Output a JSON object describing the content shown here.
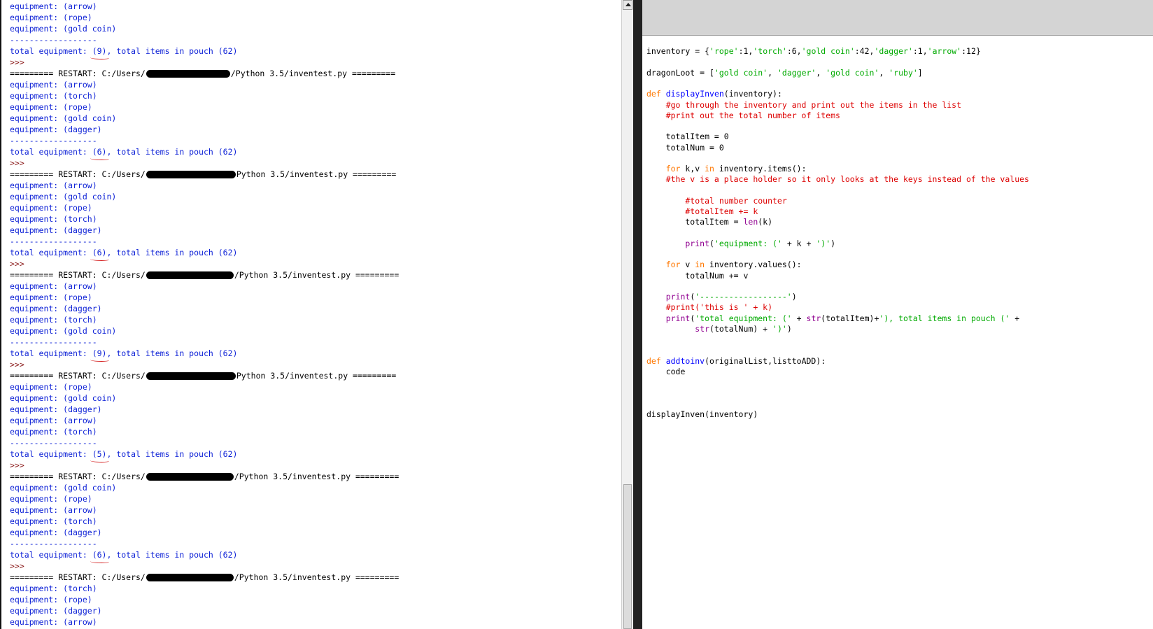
{
  "shell": {
    "lines": [
      {
        "t": "equipment: (arrow)",
        "k": "out"
      },
      {
        "t": "equipment: (rope)",
        "k": "out"
      },
      {
        "t": "equipment: (gold coin)",
        "k": "out"
      },
      {
        "t": "------------------",
        "k": "out"
      },
      {
        "pre": "total equipment: ",
        "num": "(9)",
        "post": ", total items in pouch (62)",
        "k": "total"
      },
      {
        "t": ">>>",
        "k": "prompt"
      },
      {
        "pre": "========= RESTART: C:/Users/",
        "post": "/Python 3.5/inventest.py =========",
        "k": "restart",
        "rw": 120
      },
      {
        "t": "equipment: (arrow)",
        "k": "out"
      },
      {
        "t": "equipment: (torch)",
        "k": "out"
      },
      {
        "t": "equipment: (rope)",
        "k": "out"
      },
      {
        "t": "equipment: (gold coin)",
        "k": "out"
      },
      {
        "t": "equipment: (dagger)",
        "k": "out"
      },
      {
        "t": "------------------",
        "k": "out"
      },
      {
        "pre": "total equipment: ",
        "num": "(6)",
        "post": ", total items in pouch (62)",
        "k": "total"
      },
      {
        "t": ">>>",
        "k": "prompt"
      },
      {
        "pre": "========= RESTART: C:/Users/",
        "post": "Python 3.5/inventest.py =========",
        "k": "restart",
        "rw": 128
      },
      {
        "t": "equipment: (arrow)",
        "k": "out"
      },
      {
        "t": "equipment: (gold coin)",
        "k": "out"
      },
      {
        "t": "equipment: (rope)",
        "k": "out"
      },
      {
        "t": "equipment: (torch)",
        "k": "out"
      },
      {
        "t": "equipment: (dagger)",
        "k": "out"
      },
      {
        "t": "------------------",
        "k": "out"
      },
      {
        "pre": "total equipment: ",
        "num": "(6)",
        "post": ", total items in pouch (62)",
        "k": "total"
      },
      {
        "t": ">>>",
        "k": "prompt"
      },
      {
        "pre": "========= RESTART: C:/Users/",
        "post": "/Python 3.5/inventest.py =========",
        "k": "restart",
        "rw": 125
      },
      {
        "t": "equipment: (arrow)",
        "k": "out"
      },
      {
        "t": "equipment: (rope)",
        "k": "out"
      },
      {
        "t": "equipment: (dagger)",
        "k": "out"
      },
      {
        "t": "equipment: (torch)",
        "k": "out"
      },
      {
        "t": "equipment: (gold coin)",
        "k": "out"
      },
      {
        "t": "------------------",
        "k": "out"
      },
      {
        "pre": "total equipment: ",
        "num": "(9)",
        "post": ", total items in pouch (62)",
        "k": "total"
      },
      {
        "t": ">>>",
        "k": "prompt"
      },
      {
        "pre": "========= RESTART: C:/Users/",
        "post": "Python 3.5/inventest.py =========",
        "k": "restart",
        "rw": 128
      },
      {
        "t": "equipment: (rope)",
        "k": "out"
      },
      {
        "t": "equipment: (gold coin)",
        "k": "out"
      },
      {
        "t": "equipment: (dagger)",
        "k": "out"
      },
      {
        "t": "equipment: (arrow)",
        "k": "out"
      },
      {
        "t": "equipment: (torch)",
        "k": "out"
      },
      {
        "t": "------------------",
        "k": "out"
      },
      {
        "pre": "total equipment: ",
        "num": "(5)",
        "post": ", total items in pouch (62)",
        "k": "total"
      },
      {
        "t": ">>>",
        "k": "prompt"
      },
      {
        "pre": "========= RESTART: C:/Users/",
        "post": "/Python 3.5/inventest.py =========",
        "k": "restart",
        "rw": 125
      },
      {
        "t": "equipment: (gold coin)",
        "k": "out"
      },
      {
        "t": "equipment: (rope)",
        "k": "out"
      },
      {
        "t": "equipment: (arrow)",
        "k": "out"
      },
      {
        "t": "equipment: (torch)",
        "k": "out"
      },
      {
        "t": "equipment: (dagger)",
        "k": "out"
      },
      {
        "t": "------------------",
        "k": "out"
      },
      {
        "pre": "total equipment: ",
        "num": "(6)",
        "post": ", total items in pouch (62)",
        "k": "total"
      },
      {
        "t": ">>>",
        "k": "prompt"
      },
      {
        "pre": "========= RESTART: C:/Users/",
        "post": "/Python 3.5/inventest.py =========",
        "k": "restart",
        "rw": 125
      },
      {
        "t": "equipment: (torch)",
        "k": "out"
      },
      {
        "t": "equipment: (rope)",
        "k": "out"
      },
      {
        "t": "equipment: (dagger)",
        "k": "out"
      },
      {
        "t": "equipment: (arrow)",
        "k": "out"
      }
    ]
  },
  "editor": {
    "lines": [
      [],
      [
        [
          "tx",
          "inventory = {"
        ],
        [
          "str",
          "'rope'"
        ],
        [
          "tx",
          ":1,"
        ],
        [
          "str",
          "'torch'"
        ],
        [
          "tx",
          ":6,"
        ],
        [
          "str",
          "'gold coin'"
        ],
        [
          "tx",
          ":42,"
        ],
        [
          "str",
          "'dagger'"
        ],
        [
          "tx",
          ":1,"
        ],
        [
          "str",
          "'arrow'"
        ],
        [
          "tx",
          ":12}"
        ]
      ],
      [],
      [
        [
          "tx",
          "dragonLoot = ["
        ],
        [
          "str",
          "'gold coin'"
        ],
        [
          "tx",
          ", "
        ],
        [
          "str",
          "'dagger'"
        ],
        [
          "tx",
          ", "
        ],
        [
          "str",
          "'gold coin'"
        ],
        [
          "tx",
          ", "
        ],
        [
          "str",
          "'ruby'"
        ],
        [
          "tx",
          "]"
        ]
      ],
      [],
      [
        [
          "kw",
          "def "
        ],
        [
          "fn",
          "displayInven"
        ],
        [
          "tx",
          "(inventory):"
        ]
      ],
      [
        [
          "cmt",
          "    #go through the inventory and print out the items in the list"
        ]
      ],
      [
        [
          "cmt",
          "    #print out the total number of items"
        ]
      ],
      [],
      [
        [
          "tx",
          "    totalItem = 0"
        ]
      ],
      [
        [
          "tx",
          "    totalNum = 0"
        ]
      ],
      [],
      [
        [
          "kw",
          "    for "
        ],
        [
          "tx",
          "k,v "
        ],
        [
          "kw",
          "in "
        ],
        [
          "tx",
          "inventory.items():"
        ]
      ],
      [
        [
          "cmt",
          "    #the v is a place holder so it only looks at the keys instead of the values"
        ]
      ],
      [],
      [
        [
          "cmt",
          "        #total number counter"
        ]
      ],
      [
        [
          "cmt",
          "        #totalItem += k"
        ]
      ],
      [
        [
          "tx",
          "        totalItem = "
        ],
        [
          "bi",
          "len"
        ],
        [
          "tx",
          "(k)"
        ]
      ],
      [],
      [
        [
          "bi",
          "        print"
        ],
        [
          "tx",
          "("
        ],
        [
          "str",
          "'equipment: ('"
        ],
        [
          "tx",
          " + k + "
        ],
        [
          "str",
          "')'"
        ],
        [
          "tx",
          ")"
        ]
      ],
      [],
      [
        [
          "kw",
          "    for "
        ],
        [
          "tx",
          "v "
        ],
        [
          "kw",
          "in "
        ],
        [
          "tx",
          "inventory.values():"
        ]
      ],
      [
        [
          "tx",
          "        totalNum += v"
        ]
      ],
      [],
      [
        [
          "bi",
          "    print"
        ],
        [
          "tx",
          "("
        ],
        [
          "str",
          "'------------------'"
        ],
        [
          "tx",
          ")"
        ]
      ],
      [
        [
          "cmt",
          "    #print('this is ' + k)"
        ]
      ],
      [
        [
          "bi",
          "    print"
        ],
        [
          "tx",
          "("
        ],
        [
          "str",
          "'total equipment: ('"
        ],
        [
          "tx",
          " + "
        ],
        [
          "bi",
          "str"
        ],
        [
          "tx",
          "(totalItem)+"
        ],
        [
          "str",
          "'), total items in pouch ('"
        ],
        [
          "tx",
          " +"
        ]
      ],
      [
        [
          "bi",
          "          str"
        ],
        [
          "tx",
          "(totalNum) + "
        ],
        [
          "str",
          "')'"
        ],
        [
          "tx",
          ")"
        ]
      ],
      [],
      [],
      [
        [
          "kw",
          "def "
        ],
        [
          "fn",
          "addtoinv"
        ],
        [
          "tx",
          "(originalList,listtoADD):"
        ]
      ],
      [
        [
          "tx",
          "    code"
        ]
      ],
      [],
      [],
      [],
      [
        [
          "tx",
          "displayInven(inventory)"
        ]
      ]
    ]
  },
  "colors": {
    "shell_output": "#0b1fd6",
    "prompt": "#8b1a1a",
    "keyword": "#ff7700",
    "string": "#00aa00",
    "comment": "#dd0000",
    "builtin": "#900090",
    "defname": "#0000ff",
    "underline": "#d41b1b"
  }
}
